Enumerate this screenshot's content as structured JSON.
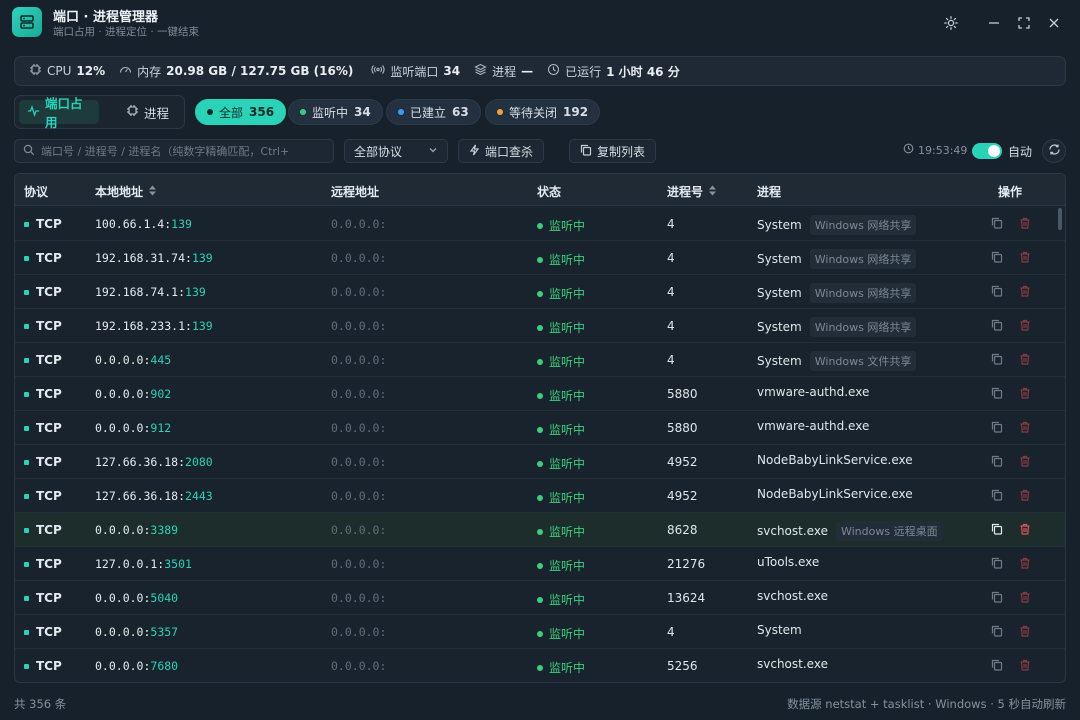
{
  "app": {
    "title": "端口 · 进程管理器",
    "subtitle": "端口占用 · 进程定位 · 一键结束",
    "accent": "#2ad2b8",
    "icon": "server-icon"
  },
  "stats": {
    "cpu_label": "CPU",
    "cpu_value": "12%",
    "mem_label": "内存",
    "mem_value": "20.98 GB / 127.75 GB (16%)",
    "listen_label": "监听端口",
    "listen_value": "34",
    "proc_label": "进程",
    "proc_value": "—",
    "uptime_label": "已运行",
    "uptime_value": "1 小时 46 分"
  },
  "view_tabs": {
    "ports": "端口占用",
    "processes": "进程"
  },
  "filters": [
    {
      "label": "全部",
      "count": "356",
      "color": "#0d2a27",
      "active": true
    },
    {
      "label": "监听中",
      "count": "34",
      "color": "#3ad07a",
      "active": false
    },
    {
      "label": "已建立",
      "count": "63",
      "color": "#3d9ef0",
      "active": false
    },
    {
      "label": "等待关闭",
      "count": "192",
      "color": "#f0a23d",
      "active": false
    }
  ],
  "toolbar": {
    "search_placeholder": "端口号 / 进程号 / 进程名（纯数字精确匹配，Ctrl+",
    "protocol_select": "全部协议",
    "port_kill": "端口查杀",
    "copy_list": "复制列表",
    "time": "19:53:49",
    "auto_label": "自动"
  },
  "table": {
    "headers": {
      "proto": "协议",
      "local": "本地地址",
      "remote": "远程地址",
      "state": "状态",
      "pid": "进程号",
      "proc": "进程",
      "actions": "操作"
    },
    "rows": [
      {
        "proto": "TCP",
        "ip": "100.66.1.4:",
        "port": "139",
        "remote": "0.0.0.0:",
        "state": "监听中",
        "pid": "4",
        "proc": "System",
        "tag": "Windows 网络共享"
      },
      {
        "proto": "TCP",
        "ip": "192.168.31.74:",
        "port": "139",
        "remote": "0.0.0.0:",
        "state": "监听中",
        "pid": "4",
        "proc": "System",
        "tag": "Windows 网络共享"
      },
      {
        "proto": "TCP",
        "ip": "192.168.74.1:",
        "port": "139",
        "remote": "0.0.0.0:",
        "state": "监听中",
        "pid": "4",
        "proc": "System",
        "tag": "Windows 网络共享"
      },
      {
        "proto": "TCP",
        "ip": "192.168.233.1:",
        "port": "139",
        "remote": "0.0.0.0:",
        "state": "监听中",
        "pid": "4",
        "proc": "System",
        "tag": "Windows 网络共享"
      },
      {
        "proto": "TCP",
        "ip": "0.0.0.0:",
        "port": "445",
        "remote": "0.0.0.0:",
        "state": "监听中",
        "pid": "4",
        "proc": "System",
        "tag": "Windows 文件共享"
      },
      {
        "proto": "TCP",
        "ip": "0.0.0.0:",
        "port": "902",
        "remote": "0.0.0.0:",
        "state": "监听中",
        "pid": "5880",
        "proc": "vmware-authd.exe",
        "tag": ""
      },
      {
        "proto": "TCP",
        "ip": "0.0.0.0:",
        "port": "912",
        "remote": "0.0.0.0:",
        "state": "监听中",
        "pid": "5880",
        "proc": "vmware-authd.exe",
        "tag": ""
      },
      {
        "proto": "TCP",
        "ip": "127.66.36.18:",
        "port": "2080",
        "remote": "0.0.0.0:",
        "state": "监听中",
        "pid": "4952",
        "proc": "NodeBabyLinkService.exe",
        "tag": ""
      },
      {
        "proto": "TCP",
        "ip": "127.66.36.18:",
        "port": "2443",
        "remote": "0.0.0.0:",
        "state": "监听中",
        "pid": "4952",
        "proc": "NodeBabyLinkService.exe",
        "tag": ""
      },
      {
        "proto": "TCP",
        "ip": "0.0.0.0:",
        "port": "3389",
        "remote": "0.0.0.0:",
        "state": "监听中",
        "pid": "8628",
        "proc": "svchost.exe",
        "tag": "Windows 远程桌面",
        "highlight": true
      },
      {
        "proto": "TCP",
        "ip": "127.0.0.1:",
        "port": "3501",
        "remote": "0.0.0.0:",
        "state": "监听中",
        "pid": "21276",
        "proc": "uTools.exe",
        "tag": ""
      },
      {
        "proto": "TCP",
        "ip": "0.0.0.0:",
        "port": "5040",
        "remote": "0.0.0.0:",
        "state": "监听中",
        "pid": "13624",
        "proc": "svchost.exe",
        "tag": ""
      },
      {
        "proto": "TCP",
        "ip": "0.0.0.0:",
        "port": "5357",
        "remote": "0.0.0.0:",
        "state": "监听中",
        "pid": "4",
        "proc": "System",
        "tag": ""
      },
      {
        "proto": "TCP",
        "ip": "0.0.0.0:",
        "port": "7680",
        "remote": "0.0.0.0:",
        "state": "监听中",
        "pid": "5256",
        "proc": "svchost.exe",
        "tag": ""
      }
    ]
  },
  "footer": {
    "count": "共 356 条",
    "source": "数据源 netstat + tasklist · Windows · 5 秒自动刷新"
  }
}
